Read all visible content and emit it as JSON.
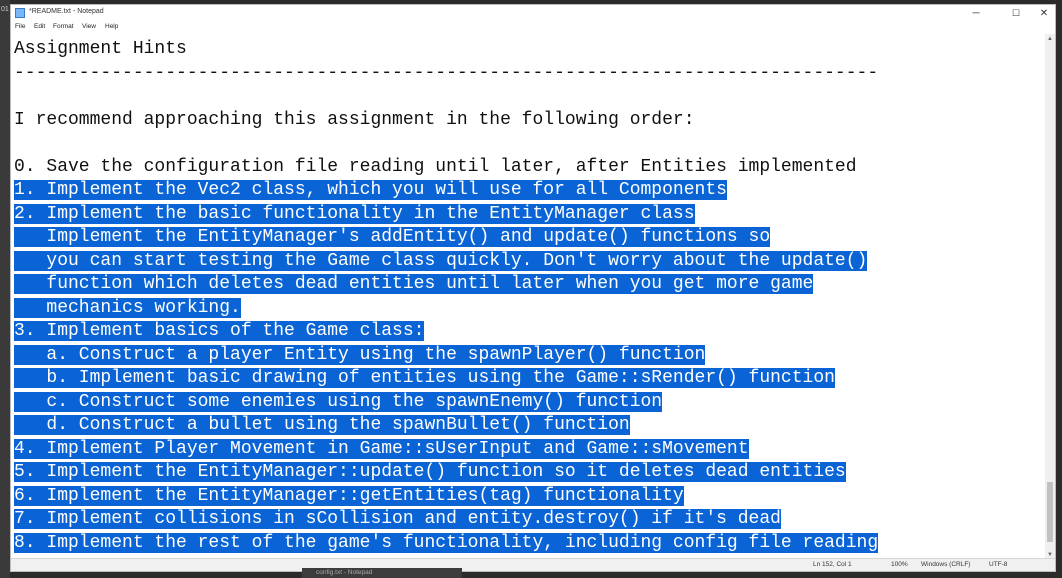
{
  "window": {
    "title": "*README.txt - Notepad",
    "controls": {
      "minimize": "─",
      "maximize": "☐",
      "close": "✕"
    }
  },
  "menu": [
    "File",
    "Edit",
    "Format",
    "View",
    "Help"
  ],
  "editor": {
    "lines": [
      {
        "text": "Assignment Hints",
        "selected": false
      },
      {
        "text": "--------------------------------------------------------------------------------",
        "selected": false
      },
      {
        "text": "",
        "selected": false
      },
      {
        "text": "I recommend approaching this assignment in the following order:",
        "selected": false
      },
      {
        "text": "",
        "selected": false
      },
      {
        "text": "0. Save the configuration file reading until later, after Entities implemented",
        "selected": false
      },
      {
        "text": "1. Implement the Vec2 class, which you will use for all Components",
        "selected": true
      },
      {
        "text": "2. Implement the basic functionality in the EntityManager class",
        "selected": true
      },
      {
        "text": "   Implement the EntityManager's addEntity() and update() functions so",
        "selected": true
      },
      {
        "text": "   you can start testing the Game class quickly. Don't worry about the update()",
        "selected": true
      },
      {
        "text": "   function which deletes dead entities until later when you get more game",
        "selected": true
      },
      {
        "text": "   mechanics working.",
        "selected": true
      },
      {
        "text": "3. Implement basics of the Game class:",
        "selected": true
      },
      {
        "text": "   a. Construct a player Entity using the spawnPlayer() function",
        "selected": true
      },
      {
        "text": "   b. Implement basic drawing of entities using the Game::sRender() function",
        "selected": true
      },
      {
        "text": "   c. Construct some enemies using the spawnEnemy() function",
        "selected": true
      },
      {
        "text": "   d. Construct a bullet using the spawnBullet() function",
        "selected": true
      },
      {
        "text": "4. Implement Player Movement in Game::sUserInput and Game::sMovement",
        "selected": true
      },
      {
        "text": "5. Implement the EntityManager::update() function so it deletes dead entities",
        "selected": true
      },
      {
        "text": "6. Implement the EntityManager::getEntities(tag) functionality",
        "selected": true
      },
      {
        "text": "7. Implement collisions in sCollision and entity.destroy() if it's dead",
        "selected": true
      },
      {
        "text": "8. Implement the rest of the game's functionality, including config file reading",
        "selected": true
      }
    ]
  },
  "status": {
    "position": "Ln 152, Col 1",
    "zoom": "100%",
    "line_ending": "Windows (CRLF)",
    "encoding": "UTF-8"
  },
  "taskbar_peek": "config.txt - Notepad",
  "colors": {
    "selection": "#0a64d6",
    "selection_text": "#ffffff"
  }
}
